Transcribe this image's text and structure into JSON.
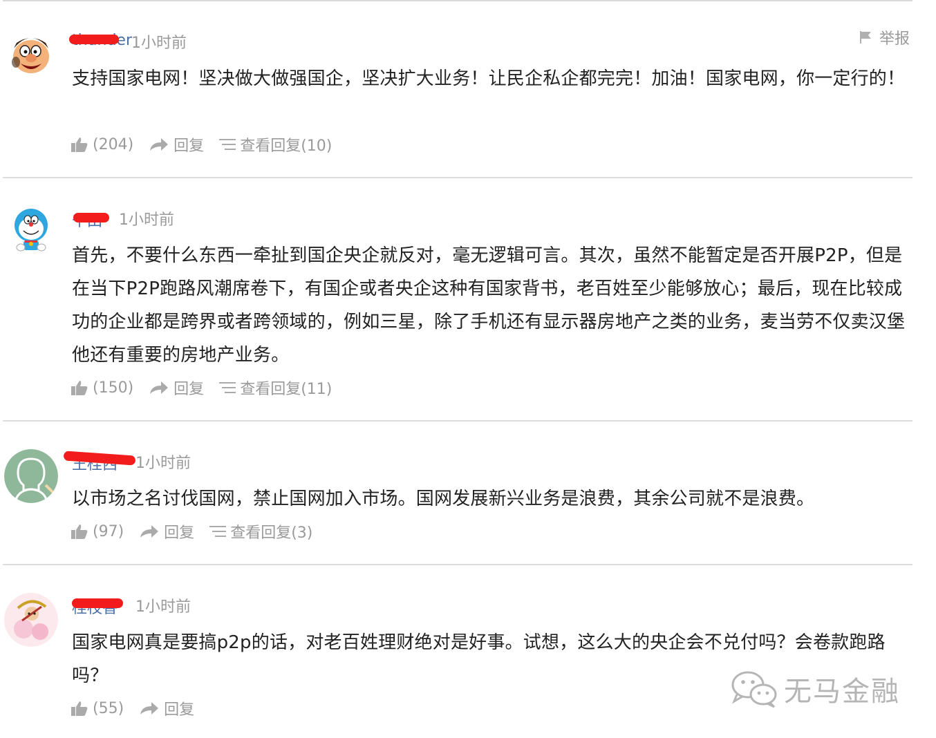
{
  "report_label": "举报",
  "watermark": {
    "icon": "wechat-icon",
    "text": "无马金融"
  },
  "labels": {
    "reply": "回复",
    "view_replies": "查看回复"
  },
  "comments": [
    {
      "username": "thunder",
      "time": "1小时前",
      "text": "支持国家电网！坚决做大做强国企，坚决扩大业务！让民企私企都完完！加油！国家电网，你一定行的！",
      "likes": "(204)",
      "reply_label": "回复",
      "view_replies_label": "查看回复(10)"
    },
    {
      "username": "千田",
      "time": "1小时前",
      "text": "首先，不要什么东西一牵扯到国企央企就反对，毫无逻辑可言。其次，虽然不能暂定是否开展P2P，但是在当下P2P跑路风潮席卷下，有国企或者央企这种有国家背书，老百姓至少能够放心；最后，现在比较成功的企业都是跨界或者跨领域的，例如三星，除了手机还有显示器房地产之类的业务，麦当劳不仅卖汉堡他还有重要的房地产业务。",
      "likes": "(150)",
      "reply_label": "回复",
      "view_replies_label": "查看回复(11)"
    },
    {
      "username": "王桂西",
      "time": "1小时前",
      "text": "以市场之名讨伐国网，禁止国网加入市场。国网发展新兴业务是浪费，其余公司就不是浪费。",
      "likes": "(97)",
      "reply_label": "回复",
      "view_replies_label": "查看回复(3)"
    },
    {
      "username": "桂枝香",
      "time": "1小时前",
      "text": "国家电网真是要搞p2p的话，对老百姓理财绝对是好事。试想，这么大的央企会不兑付吗？会卷款跑路吗？",
      "likes": "(55)",
      "reply_label": "回复"
    }
  ],
  "colors": {
    "redaction": "#f21c1c",
    "meta_gray": "#999999",
    "username_blue": "#4a6fa5"
  }
}
